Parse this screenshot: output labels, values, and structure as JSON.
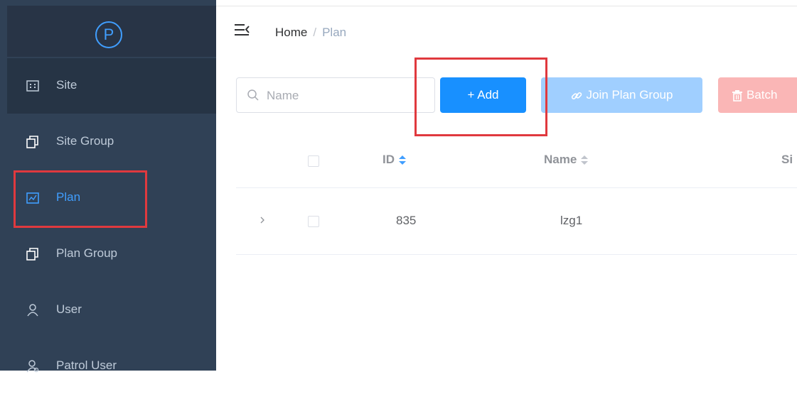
{
  "logo": {
    "letter": "P"
  },
  "sidebar": {
    "items": [
      {
        "label": "Site",
        "icon": "site-icon"
      },
      {
        "label": "Site Group",
        "icon": "copy-icon"
      },
      {
        "label": "Plan",
        "icon": "plan-icon",
        "active": true
      },
      {
        "label": "Plan Group",
        "icon": "copy-icon"
      },
      {
        "label": "User",
        "icon": "user-icon"
      },
      {
        "label": "Patrol User",
        "icon": "patrol-user-icon"
      }
    ]
  },
  "header": {
    "breadcrumb": {
      "home": "Home",
      "separator": "/",
      "current": "Plan"
    }
  },
  "toolbar": {
    "search_placeholder": "Name",
    "add_label": "+ Add",
    "join_label": "Join Plan Group",
    "batch_label": "Batch"
  },
  "table": {
    "columns": [
      "ID",
      "Name",
      "Si"
    ],
    "rows": [
      {
        "id": "835",
        "name": "lzg1"
      }
    ]
  },
  "colors": {
    "sidebar_bg": "#304156",
    "accent": "#409EFF",
    "add_button": "#1890ff",
    "join_button": "#a0cfff",
    "batch_button": "#fab6b6",
    "highlight": "#e0393e"
  }
}
